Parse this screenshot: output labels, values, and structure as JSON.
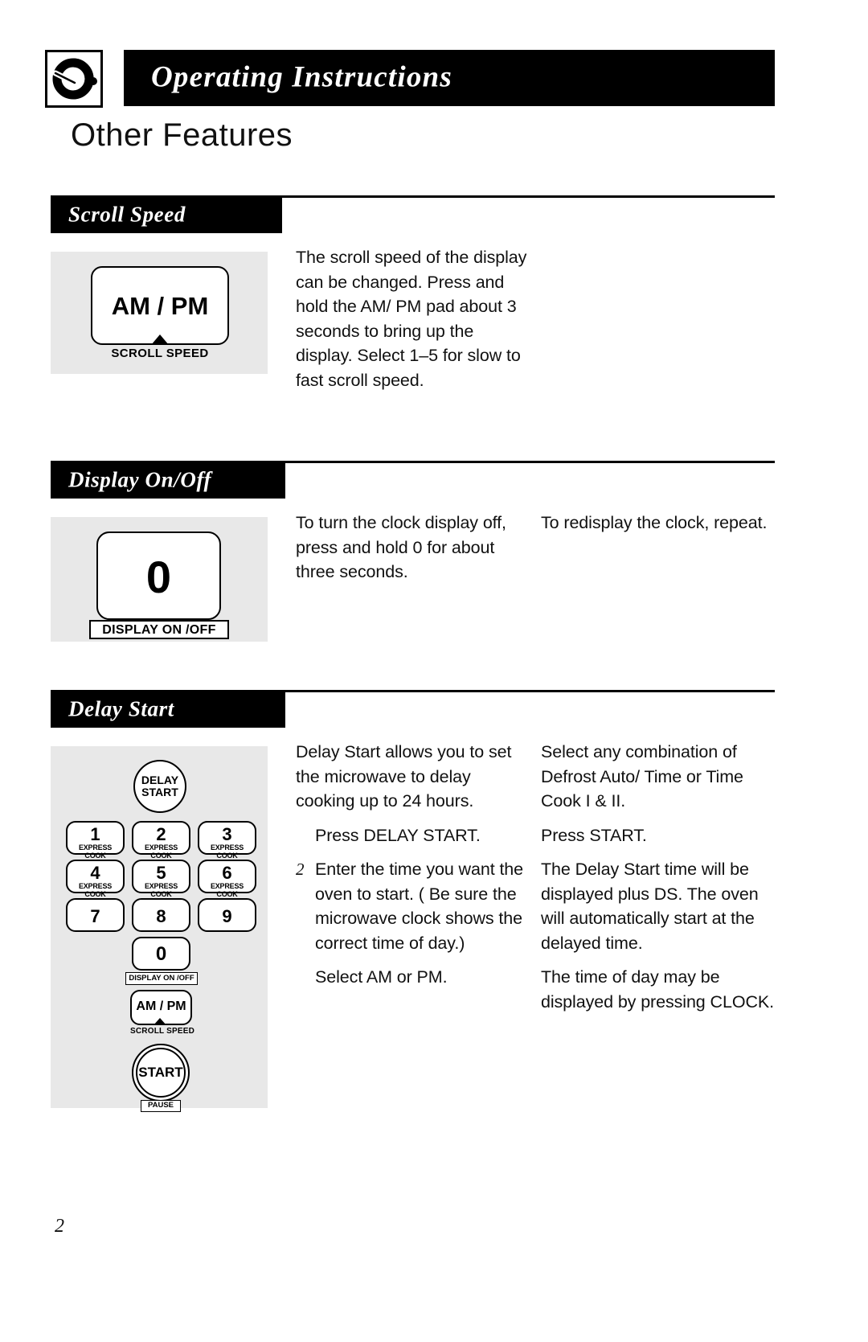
{
  "header": {
    "logo_icon": "knob-dial-icon",
    "title": "Operating Instructions",
    "page_heading": "Other Features"
  },
  "sections": [
    {
      "id": "scroll-speed",
      "band_label": "Scroll Speed",
      "figure": {
        "key_label": "AM / PM",
        "key_caption": "SCROLL SPEED"
      },
      "columns": [
        {
          "paragraphs": [
            "The scroll speed of the display can be changed. Press and hold the AM/ PM pad about 3 seconds to bring up the display. Select 1–5 for slow to fast scroll speed."
          ]
        }
      ]
    },
    {
      "id": "display-on-off",
      "band_label": "Display On/Off",
      "figure": {
        "key_label": "0",
        "key_caption": "DISPLAY ON /OFF"
      },
      "columns": [
        {
          "paragraphs": [
            "To turn the clock display off, press and hold 0 for about three seconds."
          ]
        },
        {
          "paragraphs": [
            "To redisplay the clock, repeat."
          ]
        }
      ]
    },
    {
      "id": "delay-start",
      "band_label": "Delay Start",
      "figure": {
        "delay_start_label": "DELAY\nSTART",
        "delay_start_line1": "DELAY",
        "delay_start_line2": "START",
        "keys": [
          {
            "num": "1",
            "sub": "EXPRESS COOK"
          },
          {
            "num": "2",
            "sub": "EXPRESS COOK"
          },
          {
            "num": "3",
            "sub": "EXPRESS COOK"
          },
          {
            "num": "4",
            "sub": "EXPRESS COOK"
          },
          {
            "num": "5",
            "sub": "EXPRESS COOK"
          },
          {
            "num": "6",
            "sub": "EXPRESS COOK"
          },
          {
            "num": "7",
            "sub": ""
          },
          {
            "num": "8",
            "sub": ""
          },
          {
            "num": "9",
            "sub": ""
          }
        ],
        "zero_key": "0",
        "zero_caption": "DISPLAY ON /OFF",
        "ampm_key": "AM / PM",
        "ampm_caption": "SCROLL SPEED",
        "start_key": "START",
        "start_caption": "PAUSE"
      },
      "columns": [
        {
          "intro": "Delay Start allows you to set the microwave to delay cooking up to 24 hours.",
          "steps": [
            {
              "num": "",
              "text": "Press DELAY START."
            },
            {
              "num": "2",
              "text": "Enter the time you want the oven to start. ( Be sure the microwave clock shows the correct time of day.)"
            },
            {
              "num": "",
              "text": "Select AM or PM."
            }
          ]
        },
        {
          "steps": [
            {
              "num": "",
              "text": "Select any combination of Defrost Auto/ Time or Time Cook I & II."
            },
            {
              "num": "",
              "text": "Press START."
            }
          ],
          "paragraphs": [
            "The Delay Start time will be displayed plus  DS.  The oven will automatically start at the delayed time.",
            "The time of day may be displayed by pressing CLOCK."
          ]
        }
      ]
    }
  ],
  "footer": {
    "page_number": "2"
  },
  "colors": {
    "band": "#000000",
    "panel": "#e8e8e8",
    "text": "#111111"
  }
}
